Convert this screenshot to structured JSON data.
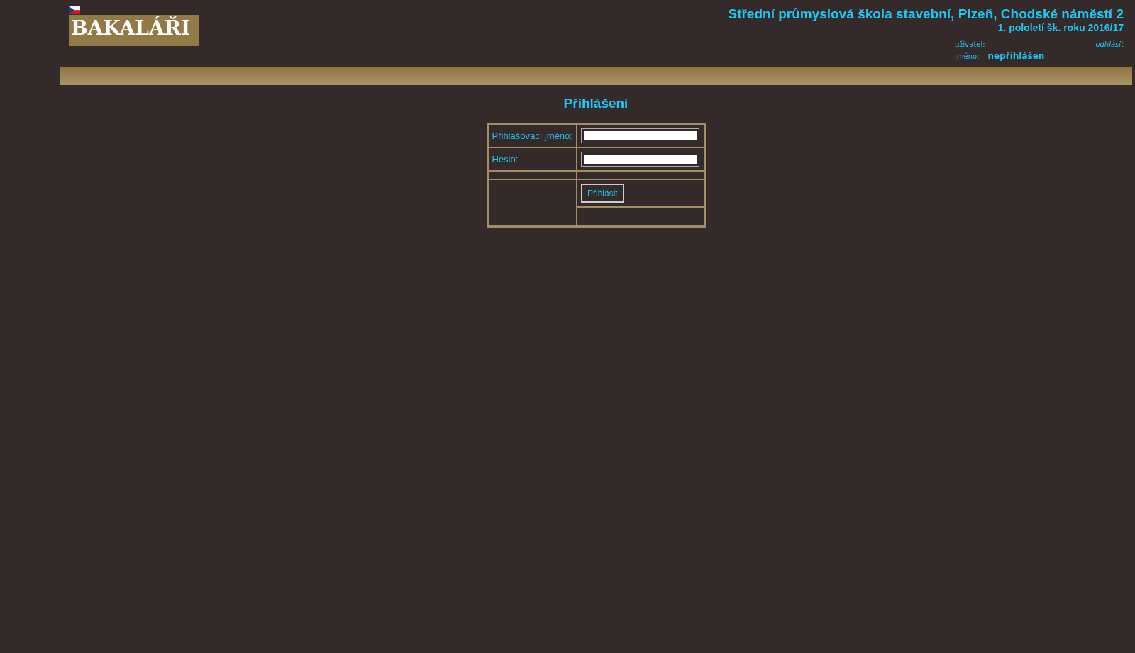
{
  "logo": {
    "text": "BAKALÁŘI"
  },
  "school": {
    "name": "Střední průmyslová škola stavební, Plzeň, Chodské náměstí 2",
    "term": "1. pololetí šk. roku 2016/17"
  },
  "user": {
    "user_label": "uživatel:",
    "logout": "odhlásit",
    "name_label": "jméno:",
    "name_value": "nepřihlášen"
  },
  "login": {
    "title": "Přihlášení",
    "fields": [
      {
        "label": "Přihlašovací jméno:"
      },
      {
        "label": "Heslo:"
      }
    ],
    "button": "Přihlásit"
  }
}
